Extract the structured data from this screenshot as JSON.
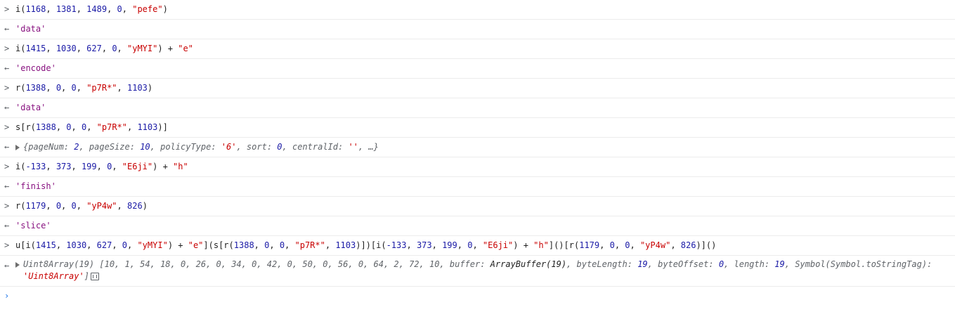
{
  "prompt_input": ">",
  "prompt_output": "←",
  "rows": [
    {
      "type": "input",
      "tokens": [
        [
          "plain",
          "i("
        ],
        [
          "num",
          "1168"
        ],
        [
          "plain",
          ", "
        ],
        [
          "num",
          "1381"
        ],
        [
          "plain",
          ", "
        ],
        [
          "num",
          "1489"
        ],
        [
          "plain",
          ", "
        ],
        [
          "num",
          "0"
        ],
        [
          "plain",
          ", "
        ],
        [
          "str",
          "\"pefe\""
        ],
        [
          "plain",
          ")"
        ]
      ]
    },
    {
      "type": "output",
      "tokens": [
        [
          "resstr",
          "'data'"
        ]
      ]
    },
    {
      "type": "input",
      "tokens": [
        [
          "plain",
          "i("
        ],
        [
          "num",
          "1415"
        ],
        [
          "plain",
          ", "
        ],
        [
          "num",
          "1030"
        ],
        [
          "plain",
          ", "
        ],
        [
          "num",
          "627"
        ],
        [
          "plain",
          ", "
        ],
        [
          "num",
          "0"
        ],
        [
          "plain",
          ", "
        ],
        [
          "str",
          "\"yMYI\""
        ],
        [
          "plain",
          ") + "
        ],
        [
          "str",
          "\"e\""
        ]
      ]
    },
    {
      "type": "output",
      "tokens": [
        [
          "resstr",
          "'encode'"
        ]
      ]
    },
    {
      "type": "input",
      "tokens": [
        [
          "plain",
          "r("
        ],
        [
          "num",
          "1388"
        ],
        [
          "plain",
          ", "
        ],
        [
          "num",
          "0"
        ],
        [
          "plain",
          ", "
        ],
        [
          "num",
          "0"
        ],
        [
          "plain",
          ", "
        ],
        [
          "str",
          "\"p7R*\""
        ],
        [
          "plain",
          ", "
        ],
        [
          "num",
          "1103"
        ],
        [
          "plain",
          ")"
        ]
      ]
    },
    {
      "type": "output",
      "tokens": [
        [
          "resstr",
          "'data'"
        ]
      ]
    },
    {
      "type": "input",
      "tokens": [
        [
          "plain",
          "s[r("
        ],
        [
          "num",
          "1388"
        ],
        [
          "plain",
          ", "
        ],
        [
          "num",
          "0"
        ],
        [
          "plain",
          ", "
        ],
        [
          "num",
          "0"
        ],
        [
          "plain",
          ", "
        ],
        [
          "str",
          "\"p7R*\""
        ],
        [
          "plain",
          ", "
        ],
        [
          "num",
          "1103"
        ],
        [
          "plain",
          ")]"
        ]
      ]
    },
    {
      "type": "object",
      "tokens": [
        [
          "key",
          "{pageNum: "
        ],
        [
          "n",
          "2"
        ],
        [
          "key",
          ", pageSize: "
        ],
        [
          "n",
          "10"
        ],
        [
          "key",
          ", policyType: "
        ],
        [
          "s",
          "'6'"
        ],
        [
          "key",
          ", sort: "
        ],
        [
          "n",
          "0"
        ],
        [
          "key",
          ", centralId: "
        ],
        [
          "s",
          "''"
        ],
        [
          "key",
          ", …}"
        ]
      ]
    },
    {
      "type": "input",
      "tokens": [
        [
          "plain",
          "i("
        ],
        [
          "num",
          "-133"
        ],
        [
          "plain",
          ", "
        ],
        [
          "num",
          "373"
        ],
        [
          "plain",
          ", "
        ],
        [
          "num",
          "199"
        ],
        [
          "plain",
          ", "
        ],
        [
          "num",
          "0"
        ],
        [
          "plain",
          ", "
        ],
        [
          "str",
          "\"E6ji\""
        ],
        [
          "plain",
          ") + "
        ],
        [
          "str",
          "\"h\""
        ]
      ]
    },
    {
      "type": "output",
      "tokens": [
        [
          "resstr",
          "'finish'"
        ]
      ]
    },
    {
      "type": "input",
      "tokens": [
        [
          "plain",
          "r("
        ],
        [
          "num",
          "1179"
        ],
        [
          "plain",
          ", "
        ],
        [
          "num",
          "0"
        ],
        [
          "plain",
          ", "
        ],
        [
          "num",
          "0"
        ],
        [
          "plain",
          ", "
        ],
        [
          "str",
          "\"yP4w\""
        ],
        [
          "plain",
          ", "
        ],
        [
          "num",
          "826"
        ],
        [
          "plain",
          ")"
        ]
      ]
    },
    {
      "type": "output",
      "tokens": [
        [
          "resstr",
          "'slice'"
        ]
      ]
    },
    {
      "type": "input",
      "tokens": [
        [
          "plain",
          "u[i("
        ],
        [
          "num",
          "1415"
        ],
        [
          "plain",
          ", "
        ],
        [
          "num",
          "1030"
        ],
        [
          "plain",
          ", "
        ],
        [
          "num",
          "627"
        ],
        [
          "plain",
          ", "
        ],
        [
          "num",
          "0"
        ],
        [
          "plain",
          ", "
        ],
        [
          "str",
          "\"yMYI\""
        ],
        [
          "plain",
          ") + "
        ],
        [
          "str",
          "\"e\""
        ],
        [
          "plain",
          "](s[r("
        ],
        [
          "num",
          "1388"
        ],
        [
          "plain",
          ", "
        ],
        [
          "num",
          "0"
        ],
        [
          "plain",
          ", "
        ],
        [
          "num",
          "0"
        ],
        [
          "plain",
          ", "
        ],
        [
          "str",
          "\"p7R*\""
        ],
        [
          "plain",
          ", "
        ],
        [
          "num",
          "1103"
        ],
        [
          "plain",
          ")])[i("
        ],
        [
          "num",
          "-133"
        ],
        [
          "plain",
          ", "
        ],
        [
          "num",
          "373"
        ],
        [
          "plain",
          ", "
        ],
        [
          "num",
          "199"
        ],
        [
          "plain",
          ", "
        ],
        [
          "num",
          "0"
        ],
        [
          "plain",
          ", "
        ],
        [
          "str",
          "\"E6ji\""
        ],
        [
          "plain",
          ") + "
        ],
        [
          "str",
          "\"h\""
        ],
        [
          "plain",
          "]()[r("
        ],
        [
          "num",
          "1179"
        ],
        [
          "plain",
          ", "
        ],
        [
          "num",
          "0"
        ],
        [
          "plain",
          ", "
        ],
        [
          "num",
          "0"
        ],
        [
          "plain",
          ", "
        ],
        [
          "str",
          "\"yP4w\""
        ],
        [
          "plain",
          ", "
        ],
        [
          "num",
          "826"
        ],
        [
          "plain",
          ")]()"
        ]
      ]
    },
    {
      "type": "array",
      "tokens": [
        [
          "key",
          "Uint8Array(19) [10, 1, 54, 18, 0, 26, 0, 34, 0, 42, 0, 50, 0, 56, 0, 64, 2, 72, 10, buffer: "
        ],
        [
          "plainit",
          "ArrayBuffer(19)"
        ],
        [
          "key",
          ", byteLength: "
        ],
        [
          "n",
          "19"
        ],
        [
          "key",
          ", byteOffset: "
        ],
        [
          "n",
          "0"
        ],
        [
          "key",
          ", length: "
        ],
        [
          "n",
          "19"
        ],
        [
          "key",
          ", Symbol(Symbol.toStringTag): "
        ],
        [
          "s",
          "'Uint8Array'"
        ],
        [
          "key",
          "]"
        ]
      ]
    }
  ],
  "caret": "›"
}
